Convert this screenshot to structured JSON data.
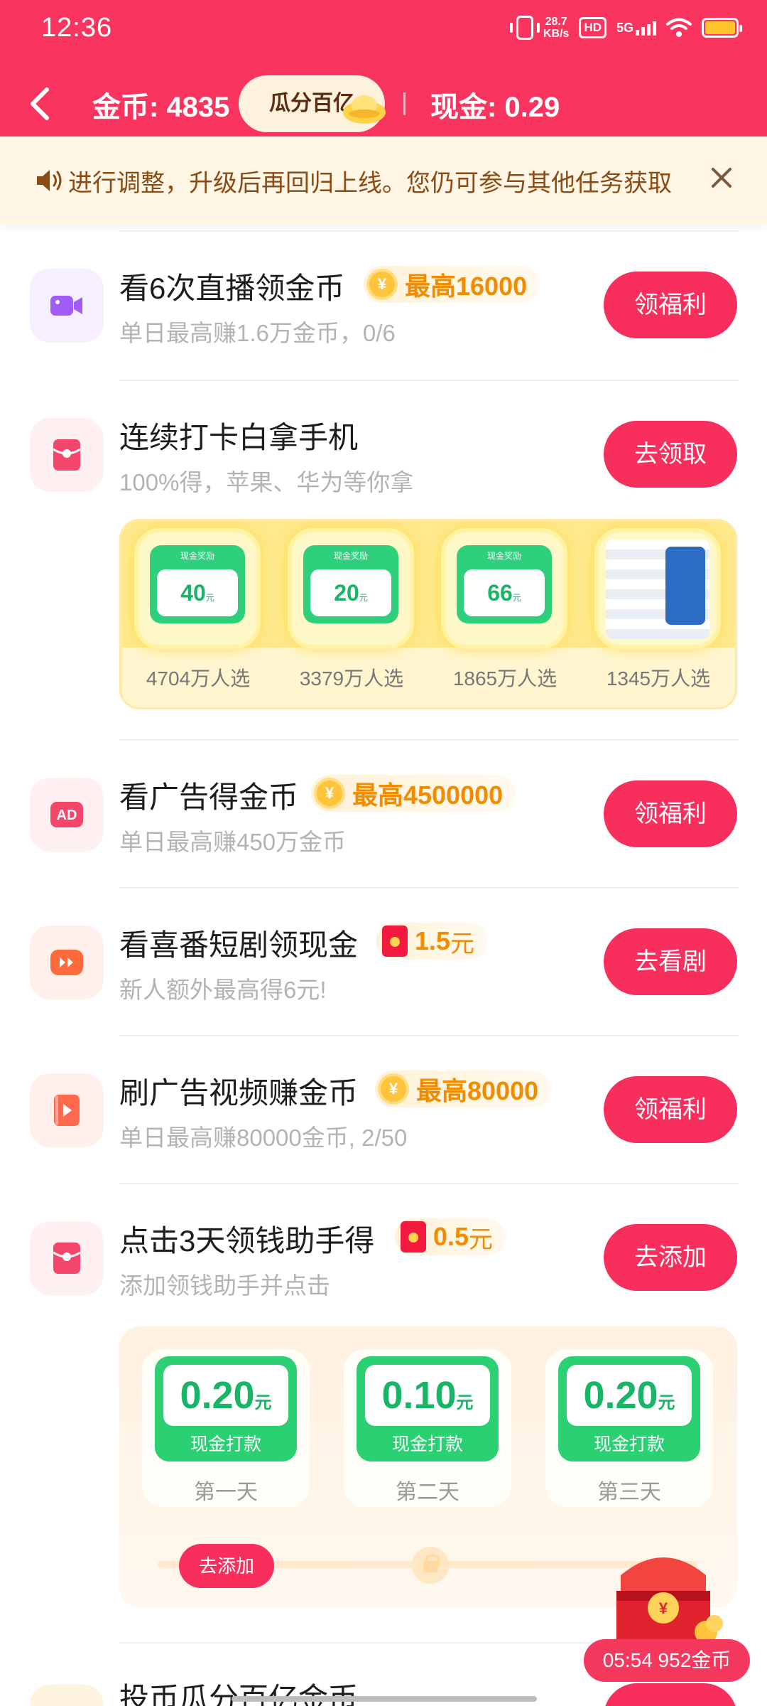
{
  "status": {
    "time": "12:36",
    "speed_top": "28.7",
    "speed_bottom": "KB/s",
    "hd": "HD",
    "net": "5G"
  },
  "nav": {
    "coins_label": "金币: 4835",
    "pill_label": "瓜分百亿",
    "cash_label": "现金: 0.29"
  },
  "notice": {
    "text": "进行调整，升级后再回归上线。您仍可参与其他任务获取"
  },
  "tasks": [
    {
      "title": "看6次直播领金币",
      "reward_lead": "最高16000",
      "reward_unit": "",
      "sub": "单日最高赚1.6万金币，0/6",
      "button": "领福利",
      "icon": "video-camera-icon",
      "icon_color": "#a05cf5"
    },
    {
      "title": "连续打卡白拿手机",
      "sub": "100%得，苹果、华为等你拿",
      "button": "去领取",
      "icon": "red-envelope-icon",
      "icon_color": "#f4456a"
    },
    {
      "title": "看广告得金币",
      "reward_lead": "最高4500000",
      "reward_unit": "",
      "sub": "单日最高赚450万金币",
      "button": "领福利",
      "icon": "ad-icon",
      "icon_color": "#f4456a"
    },
    {
      "title": "看喜番短剧领现金",
      "reward_lead": "1.5",
      "reward_unit": "元",
      "sub": "新人额外最高得6元!",
      "button": "去看剧",
      "icon": "fast-forward-icon",
      "icon_color": "#ff6a3d"
    },
    {
      "title": "刷广告视频赚金币",
      "reward_lead": "最高80000",
      "reward_unit": "",
      "sub": "单日最高赚80000金币, 2/50",
      "button": "领福利",
      "icon": "video-play-icon",
      "icon_color": "#ff6a4f"
    },
    {
      "title": "点击3天领钱助手得",
      "reward_lead": "0.5",
      "reward_unit": "元",
      "sub": "添加领钱助手并点击",
      "button": "去添加",
      "icon": "red-envelope-icon",
      "icon_color": "#f4456a"
    },
    {
      "title": "投币瓜分百亿金币"
    }
  ],
  "prizes": [
    {
      "card_header": "现金奖励",
      "amount": "40",
      "unit": "元",
      "label": "4704万人选"
    },
    {
      "card_header": "现金奖励",
      "amount": "20",
      "unit": "元",
      "label": "3379万人选"
    },
    {
      "card_header": "现金奖励",
      "amount": "66",
      "unit": "元",
      "label": "1865万人选"
    },
    {
      "label": "1345万人选"
    }
  ],
  "days": [
    {
      "amount": "0.20",
      "unit": "元",
      "cash": "现金打款",
      "label": "第一天"
    },
    {
      "amount": "0.10",
      "unit": "元",
      "cash": "现金打款",
      "label": "第二天"
    },
    {
      "amount": "0.20",
      "unit": "元",
      "cash": "现金打款",
      "label": "第三天"
    }
  ],
  "day_add_button": "去添加",
  "float_timer": "05:54 952金币",
  "colors": {
    "brand": "#f9345f",
    "button": "#f82f5c",
    "reward_text": "#f18c00",
    "cash_green": "#2bd073"
  }
}
